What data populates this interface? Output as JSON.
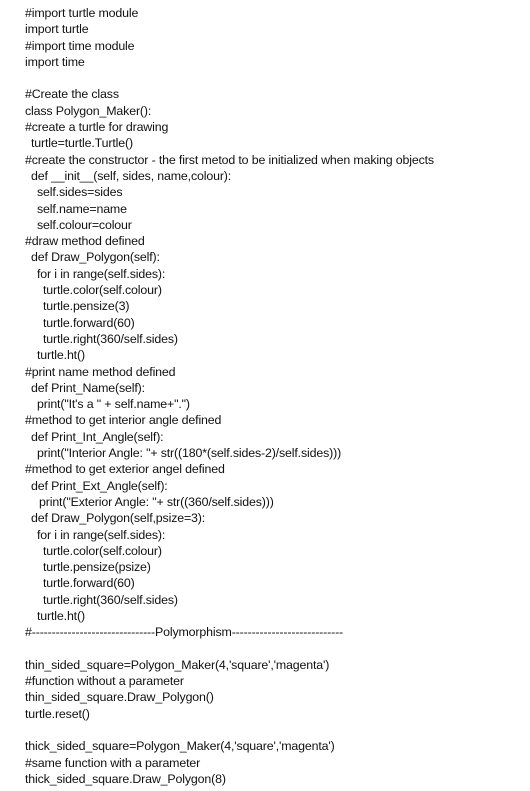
{
  "document": {
    "lines": [
      {
        "indent": 0,
        "text": "#import turtle module"
      },
      {
        "indent": 0,
        "text": "import turtle"
      },
      {
        "indent": 0,
        "text": "#import time module"
      },
      {
        "indent": 0,
        "text": "import time"
      },
      {
        "indent": 0,
        "text": ""
      },
      {
        "indent": 0,
        "text": "#Create the class"
      },
      {
        "indent": 0,
        "text": "class Polygon_Maker():"
      },
      {
        "indent": 0,
        "text": "#create a turtle for drawing"
      },
      {
        "indent": 1,
        "text": "turtle=turtle.Turtle()"
      },
      {
        "indent": 0,
        "text": "#create the constructor - the first metod to be initialized when making objects"
      },
      {
        "indent": 1,
        "text": "def __init__(self, sides, name,colour):"
      },
      {
        "indent": 2,
        "text": "self.sides=sides"
      },
      {
        "indent": 2,
        "text": "self.name=name"
      },
      {
        "indent": 2,
        "text": "self.colour=colour"
      },
      {
        "indent": 0,
        "text": "#draw method defined"
      },
      {
        "indent": 1,
        "text": "def Draw_Polygon(self):"
      },
      {
        "indent": 2,
        "text": "for i in range(self.sides):"
      },
      {
        "indent": 3,
        "text": "turtle.color(self.colour)"
      },
      {
        "indent": 3,
        "text": "turtle.pensize(3)"
      },
      {
        "indent": 3,
        "text": "turtle.forward(60)"
      },
      {
        "indent": 3,
        "text": "turtle.right(360/self.sides)"
      },
      {
        "indent": 2,
        "text": "turtle.ht()"
      },
      {
        "indent": 0,
        "text": "#print name method defined"
      },
      {
        "indent": 1,
        "text": "def Print_Name(self):"
      },
      {
        "indent": 2,
        "text": "print(\"It's a \" + self.name+\".\")"
      },
      {
        "indent": 0,
        "text": "#method to get interior angle defined"
      },
      {
        "indent": 1,
        "text": "def Print_Int_Angle(self):"
      },
      {
        "indent": 2,
        "text": "print(\"Interior Angle: \"+ str((180*(self.sides-2)/self.sides)))"
      },
      {
        "indent": 0,
        "text": "#method to get exterior angel defined"
      },
      {
        "indent": 1,
        "text": "def Print_Ext_Angle(self):"
      },
      {
        "indent": 2.5,
        "text": "print(\"Exterior Angle: \"+ str((360/self.sides)))"
      },
      {
        "indent": 1,
        "text": "def Draw_Polygon(self,psize=3):"
      },
      {
        "indent": 2,
        "text": "for i in range(self.sides):"
      },
      {
        "indent": 3,
        "text": "turtle.color(self.colour)"
      },
      {
        "indent": 3,
        "text": "turtle.pensize(psize)"
      },
      {
        "indent": 3,
        "text": "turtle.forward(60)"
      },
      {
        "indent": 3,
        "text": "turtle.right(360/self.sides)"
      },
      {
        "indent": 2,
        "text": "turtle.ht()"
      },
      {
        "indent": 0,
        "text": "#-------------------------------Polymorphism----------------------------"
      },
      {
        "indent": 0,
        "text": ""
      },
      {
        "indent": 0,
        "text": "thin_sided_square=Polygon_Maker(4,'square','magenta')"
      },
      {
        "indent": 0,
        "text": "#function without a parameter"
      },
      {
        "indent": 0,
        "text": "thin_sided_square.Draw_Polygon()"
      },
      {
        "indent": 0,
        "text": "turtle.reset()"
      },
      {
        "indent": 0,
        "text": ""
      },
      {
        "indent": 0,
        "text": "thick_sided_square=Polygon_Maker(4,'square','magenta')"
      },
      {
        "indent": 0,
        "text": "#same function with a parameter"
      },
      {
        "indent": 0,
        "text": "thick_sided_square.Draw_Polygon(8)"
      }
    ]
  }
}
